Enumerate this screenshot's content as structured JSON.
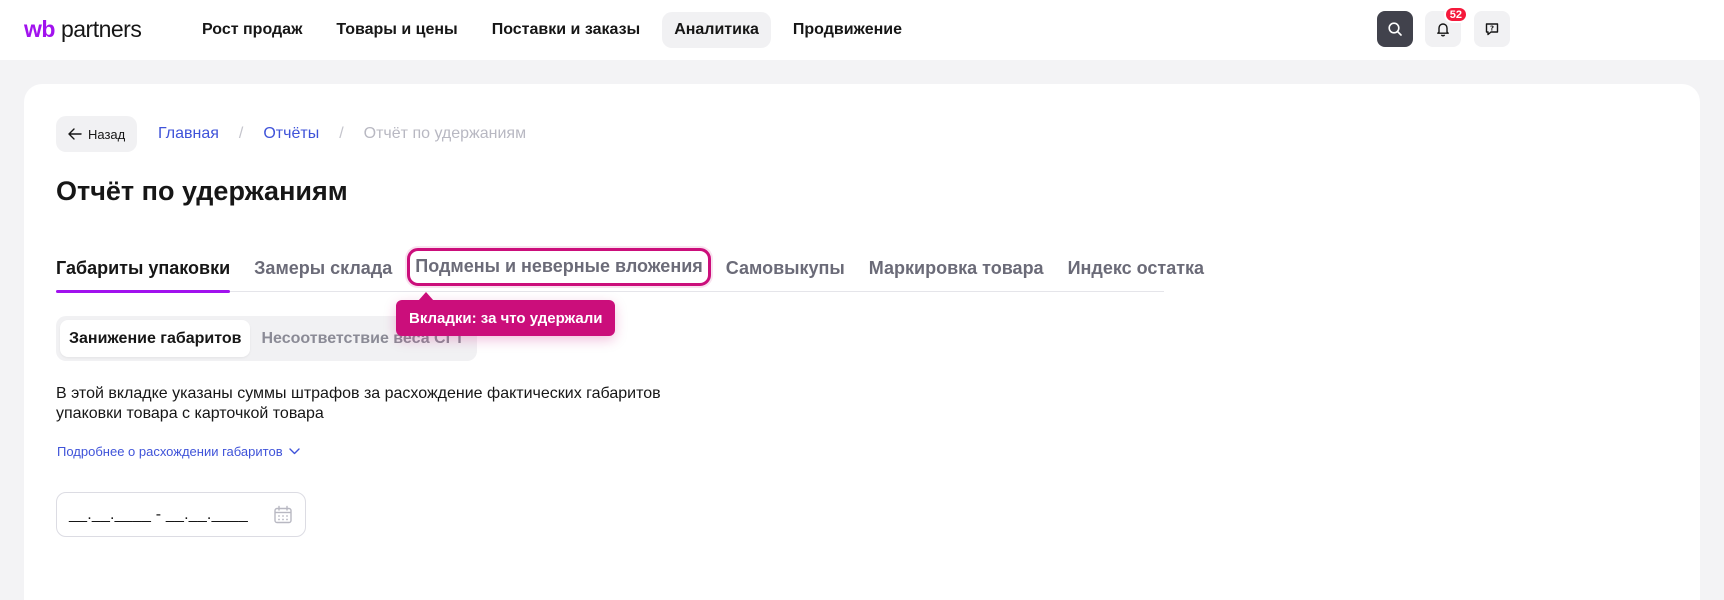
{
  "header": {
    "logo_wb": "wb",
    "logo_partners": "partners",
    "nav": [
      {
        "label": "Рост продаж",
        "active": false
      },
      {
        "label": "Товары и цены",
        "active": false
      },
      {
        "label": "Поставки и заказы",
        "active": false
      },
      {
        "label": "Аналитика",
        "active": true
      },
      {
        "label": "Продвижение",
        "active": false
      }
    ],
    "icons": {
      "search": "search-icon",
      "bell": "bell-icon",
      "chat": "chat-question-icon"
    },
    "notifications_count": "52",
    "colors": {
      "brand": "#a112ee",
      "badge": "#f5193b",
      "search_bg": "#41424c"
    }
  },
  "page": {
    "back_label": "Назад",
    "breadcrumbs": [
      {
        "label": "Главная",
        "link": true
      },
      {
        "label": "Отчёты",
        "link": true
      },
      {
        "label": "Отчёт по удержаниям",
        "link": false
      }
    ],
    "breadcrumb_separator": "/",
    "title": "Отчёт по удержаниям",
    "tabs": [
      {
        "label": "Габариты упаковки",
        "active": true
      },
      {
        "label": "Замеры склада",
        "active": false
      },
      {
        "label": "Подмены и неверные вложения",
        "active": false,
        "highlighted": true
      },
      {
        "label": "Самовыкупы",
        "active": false
      },
      {
        "label": "Маркировка товара",
        "active": false
      },
      {
        "label": "Индекс остатка",
        "active": false
      }
    ],
    "tooltip": "Вкладки: за что удержали",
    "subtabs": [
      {
        "label": "Занижение габаритов",
        "active": true
      },
      {
        "label": "Несоответствие веса СГТ",
        "active": false
      }
    ],
    "description": "В этой вкладке указаны суммы штрафов за расхождение фактических габаритов упаковки товара с карточкой товара",
    "more_link": "Подробнее о расхождении габаритов",
    "date_range_value": "__.__.____ - __.__.____",
    "colors": {
      "link": "#3f53d9",
      "tab_underline": "#a112ee",
      "highlight": "#cb0e7b"
    }
  }
}
